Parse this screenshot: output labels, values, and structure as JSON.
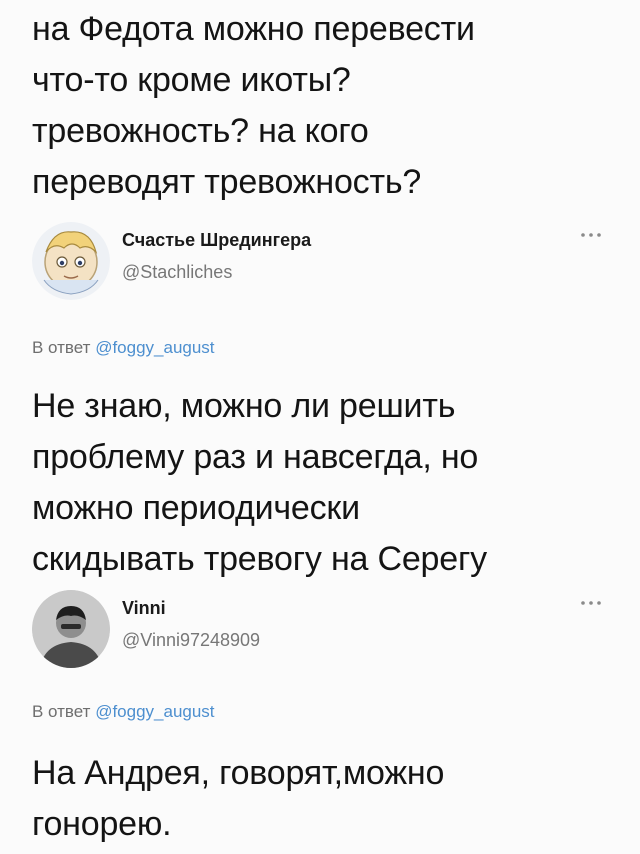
{
  "top_tweet": {
    "text": "на Федота можно перевести\nчто-то кроме икоты?\nтревожность? на кого\nпереводят тревожность?"
  },
  "reply_1": {
    "author_name": "Счастье Шредингера",
    "author_handle": "@Stachliches",
    "avatar_icon": "anime-character-avatar-icon",
    "more_icon": "more-options-icon",
    "reply_prefix": "В ответ",
    "reply_mention": "@foggy_august",
    "text": "Не знаю, можно ли решить\nпроблему раз и навсегда, но\nможно периодически\nскидывать тревогу на Серегу"
  },
  "reply_2": {
    "author_name": "Vinni",
    "author_handle": "@Vinni97248909",
    "avatar_icon": "person-avatar-icon",
    "more_icon": "more-options-icon",
    "reply_prefix": "В ответ",
    "reply_mention": "@foggy_august",
    "text": "На Андрея, говорят,можно\nгонорею."
  },
  "colors": {
    "text": "#141414",
    "muted": "#6e6e6e",
    "link": "#4d8fcf"
  }
}
